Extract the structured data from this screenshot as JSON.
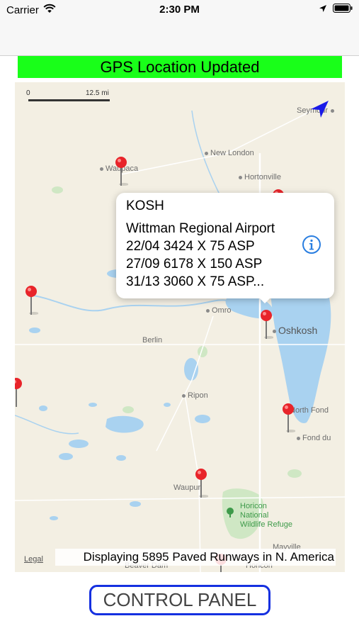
{
  "status_bar": {
    "carrier": "Carrier",
    "time": "2:30 PM",
    "icons": [
      "wifi-icon",
      "location-arrow-icon",
      "battery-icon"
    ]
  },
  "banner": {
    "text": "GPS Location Updated",
    "color": "#19ff19"
  },
  "map": {
    "scale": {
      "start": "0",
      "end": "12.5 mi"
    },
    "towns": [
      "Seymour",
      "New London",
      "Waupaca",
      "Hortonville",
      "Omro",
      "Oshkosh",
      "Berlin",
      "Ripon",
      "North Fond",
      "Fond du",
      "Waupun",
      "Mayville",
      "Beaver Dam",
      "Horicon"
    ],
    "park": [
      "Horicon",
      "National",
      "Wildlife Refuge"
    ],
    "legal": "Legal",
    "display_label": "Displaying 5895 Paved Runways in N. America",
    "pin_color": "#e8242a"
  },
  "callout": {
    "code": "KOSH",
    "name": "Wittman Regional Airport",
    "runways": [
      "22/04 3424 X 75 ASP",
      "27/09 6178 X 150 ASP",
      "31/13 3060 X 75 ASP..."
    ],
    "info_icon": "info-icon",
    "accent": "#2a7ee0"
  },
  "control_panel": {
    "label": "CONTROL PANEL",
    "border_color": "#1530e0"
  }
}
